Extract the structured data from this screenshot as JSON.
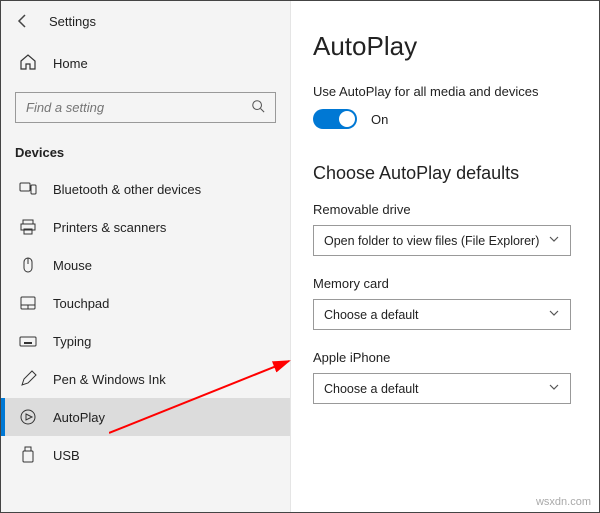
{
  "titlebar": {
    "title": "Settings"
  },
  "home": {
    "label": "Home"
  },
  "search": {
    "placeholder": "Find a setting"
  },
  "category": "Devices",
  "nav": [
    {
      "label": "Bluetooth & other devices"
    },
    {
      "label": "Printers & scanners"
    },
    {
      "label": "Mouse"
    },
    {
      "label": "Touchpad"
    },
    {
      "label": "Typing"
    },
    {
      "label": "Pen & Windows Ink"
    },
    {
      "label": "AutoPlay"
    },
    {
      "label": "USB"
    }
  ],
  "main": {
    "heading": "AutoPlay",
    "use_label": "Use AutoPlay for all media and devices",
    "toggle_state": "On",
    "defaults_heading": "Choose AutoPlay defaults",
    "fields": [
      {
        "label": "Removable drive",
        "value": "Open folder to view files (File Explorer)"
      },
      {
        "label": "Memory card",
        "value": "Choose a default"
      },
      {
        "label": "Apple iPhone",
        "value": "Choose a default"
      }
    ]
  },
  "watermark": "wsxdn.com"
}
